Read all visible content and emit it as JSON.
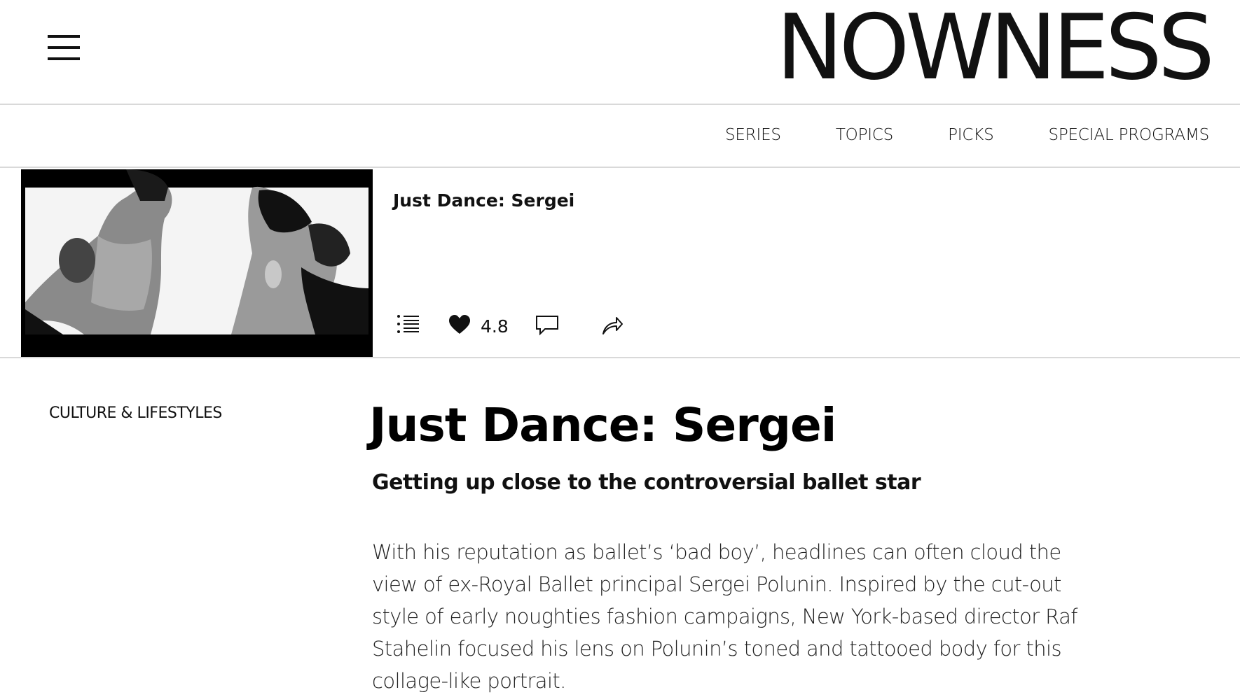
{
  "header": {
    "logo_text": "NOWNESS"
  },
  "nav": {
    "items": [
      {
        "label": "SERIES"
      },
      {
        "label": "TOPICS"
      },
      {
        "label": "PICKS"
      },
      {
        "label": "SPECIAL PROGRAMS"
      }
    ]
  },
  "video_strip": {
    "title": "Just Dance: Sergei",
    "rating": "4.8",
    "icons": [
      "playlist-icon",
      "heart-icon",
      "comment-icon",
      "share-icon"
    ]
  },
  "article": {
    "category": "CULTURE & LIFESTYLES",
    "title": "Just Dance: Sergei",
    "subtitle": "Getting up close to the controversial ballet star",
    "body": "With his reputation as ballet’s ‘bad boy’, headlines can often cloud the view of ex-Royal Ballet principal Sergei Polunin. Inspired by the cut-out style of early noughties fashion campaigns, New York-based director Raf Stahelin focused his lens on Polunin’s toned and tattooed body for this collage-like portrait."
  },
  "colors": {
    "text": "#111111",
    "divider": "#d9d9d9",
    "background": "#ffffff"
  }
}
